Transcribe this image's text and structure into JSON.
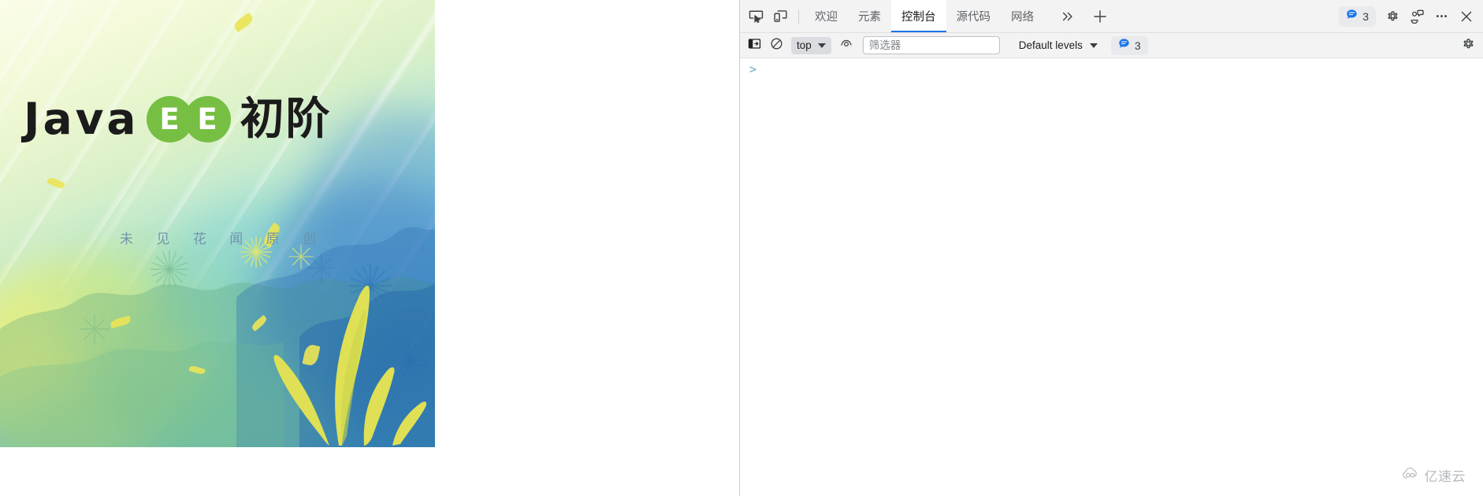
{
  "banner": {
    "title_java": "Java",
    "ee_letters": [
      "E",
      "E"
    ],
    "title_cjk": "初阶",
    "subtitle": "未 见 花 闻 原 创",
    "colors": {
      "ee_circle_green": "#76bf43",
      "title_black": "#1b1b1b",
      "subtitle_blue": "#6d8fa8"
    }
  },
  "devtools": {
    "tabbar": {
      "inspect_icon": "inspect-element-icon",
      "device_icon": "device-toolbar-icon",
      "tabs": [
        {
          "label": "欢迎",
          "active": false
        },
        {
          "label": "元素",
          "active": false
        },
        {
          "label": "控制台",
          "active": true
        },
        {
          "label": "源代码",
          "active": false
        },
        {
          "label": "网络",
          "active": false
        }
      ],
      "more_tabs_icon": "chevron-double-right-icon",
      "add_tab_icon": "plus-icon",
      "issues_badge": {
        "icon": "message-bubble-icon",
        "count": "3",
        "color": "#1a73e8"
      },
      "settings_icon": "gear-icon",
      "feedback_icon": "feedback-icon",
      "more_icon": "more-options-icon",
      "close_icon": "close-icon",
      "active_underline_color": "#1a73e8"
    },
    "toolbar": {
      "sidebar_toggle_icon": "console-sidebar-icon",
      "clear_console_icon": "clear-console-icon",
      "context_selector": {
        "value": "top",
        "caret_icon": "chevron-down-icon"
      },
      "live_expression_icon": "eye-icon",
      "filter": {
        "value": "",
        "placeholder": "筛选器"
      },
      "log_levels": {
        "value": "Default levels",
        "caret_icon": "chevron-down-icon"
      },
      "message_badge": {
        "icon": "message-bubble-icon",
        "count": "3"
      },
      "console_settings_icon": "gear-icon"
    },
    "console": {
      "prompt_symbol": ">",
      "input_value": ""
    }
  },
  "watermark": {
    "icon": "cloud-logo-icon",
    "text": "亿速云"
  }
}
